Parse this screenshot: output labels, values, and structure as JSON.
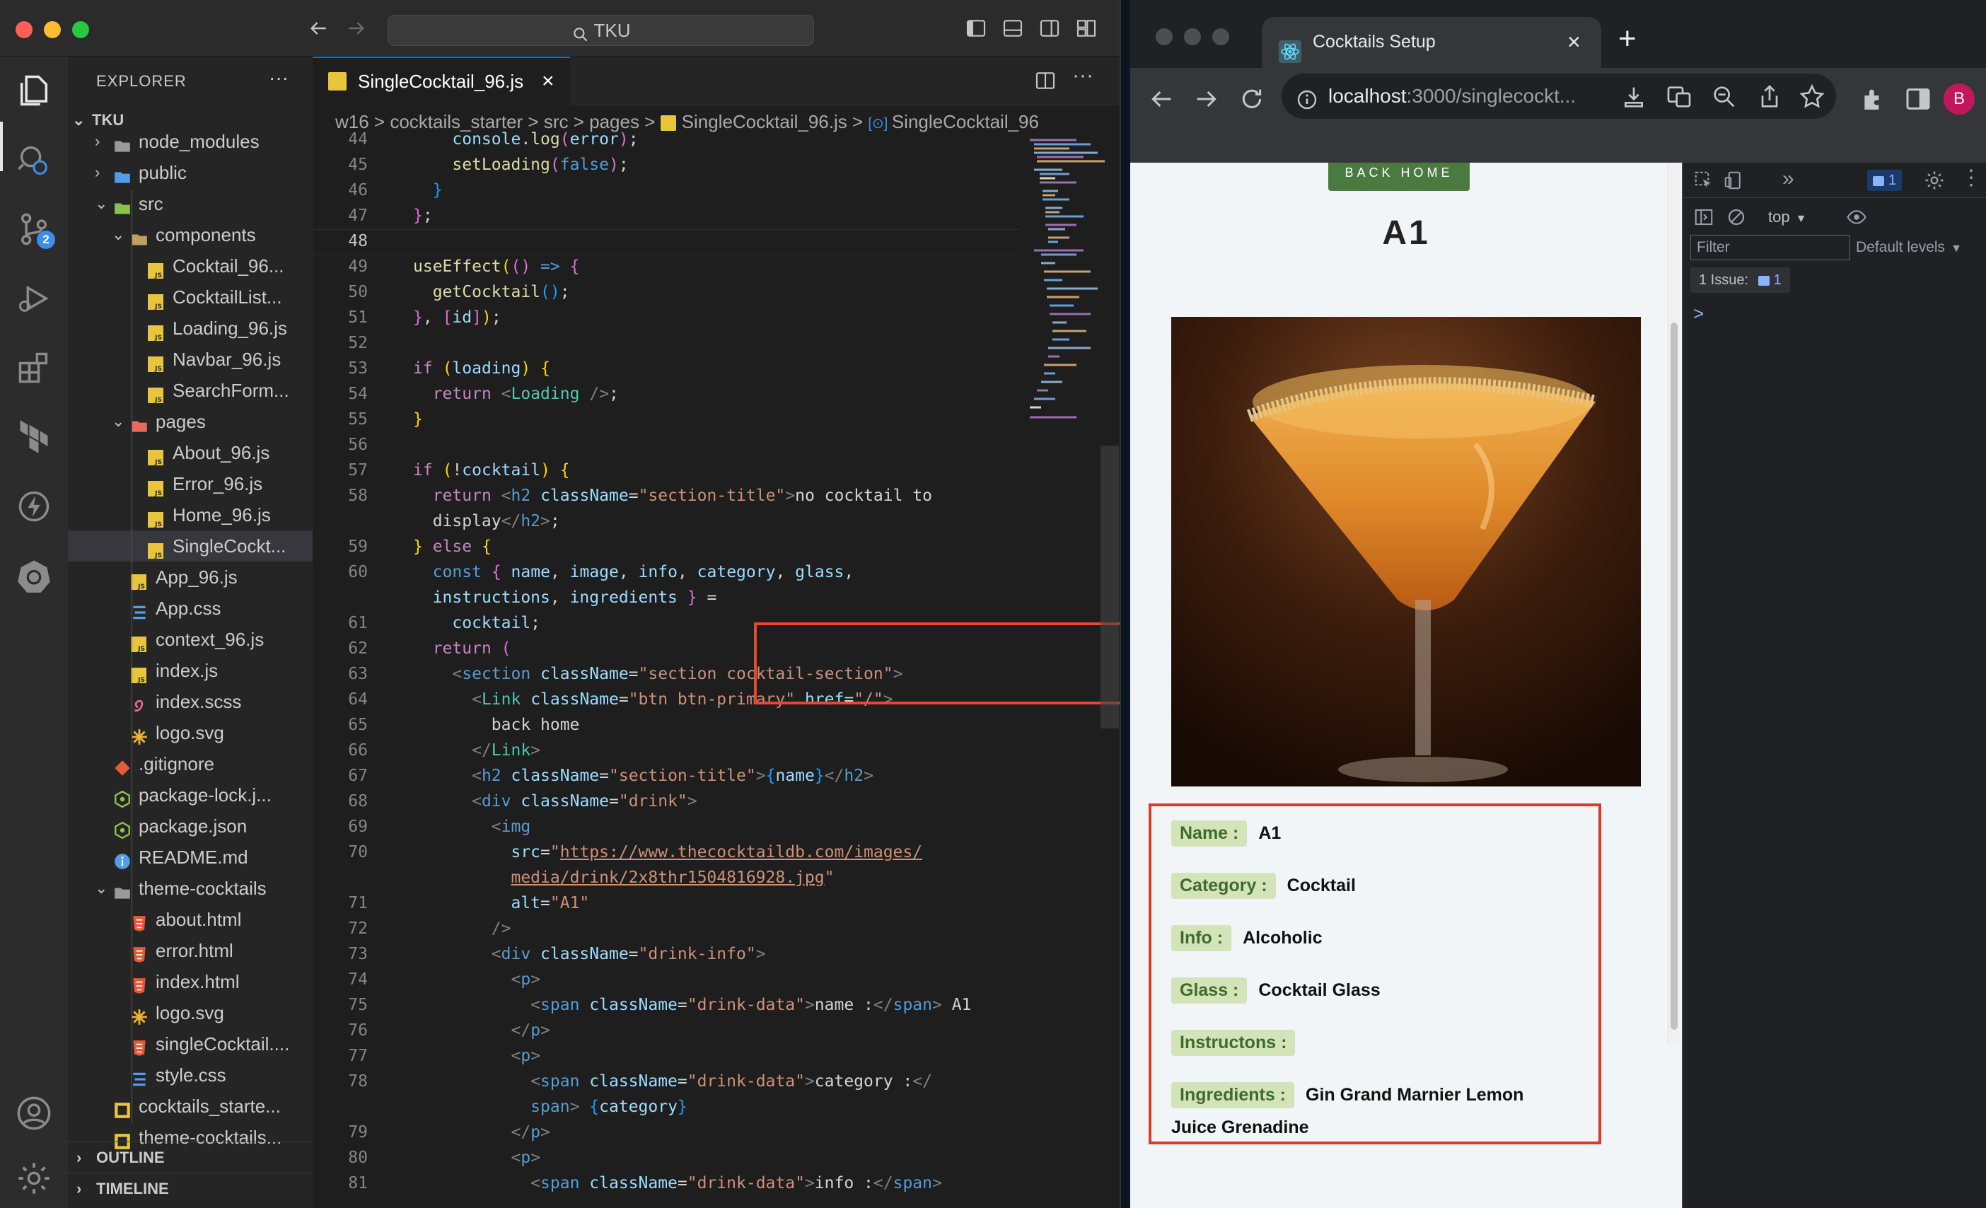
{
  "vscode": {
    "search_text": "TKU",
    "explorer_title": "EXPLORER",
    "explorer_more": "···",
    "scm_badge": "2",
    "tab_label": "SingleCocktail_96.js",
    "tab_close": "×",
    "breadcrumb": [
      "w16",
      "cocktails_starter",
      "src",
      "pages",
      "SingleCocktail_96.js",
      "SingleCocktail_96"
    ],
    "breadcrumb_sep": ">",
    "tree": [
      {
        "label": "TKU",
        "chev": "v",
        "icon": "root"
      },
      {
        "label": "node_modules",
        "chev": ">",
        "icon": "folder-node"
      },
      {
        "label": "public",
        "chev": ">",
        "icon": "folder-public"
      },
      {
        "label": "src",
        "chev": "v",
        "icon": "folder-src"
      },
      {
        "label": "components",
        "chev": "v",
        "icon": "folder-components"
      },
      {
        "label": "Cocktail_96...",
        "chev": "",
        "icon": "js"
      },
      {
        "label": "CocktailList...",
        "chev": "",
        "icon": "js"
      },
      {
        "label": "Loading_96.js",
        "chev": "",
        "icon": "js"
      },
      {
        "label": "Navbar_96.js",
        "chev": "",
        "icon": "js"
      },
      {
        "label": "SearchForm...",
        "chev": "",
        "icon": "js"
      },
      {
        "label": "pages",
        "chev": "v",
        "icon": "folder-pages"
      },
      {
        "label": "About_96.js",
        "chev": "",
        "icon": "js"
      },
      {
        "label": "Error_96.js",
        "chev": "",
        "icon": "js"
      },
      {
        "label": "Home_96.js",
        "chev": "",
        "icon": "js"
      },
      {
        "label": "SingleCockt...",
        "chev": "",
        "icon": "js"
      },
      {
        "label": "App_96.js",
        "chev": "",
        "icon": "js"
      },
      {
        "label": "App.css",
        "chev": "",
        "icon": "css"
      },
      {
        "label": "context_96.js",
        "chev": "",
        "icon": "js"
      },
      {
        "label": "index.js",
        "chev": "",
        "icon": "js"
      },
      {
        "label": "index.scss",
        "chev": "",
        "icon": "scss"
      },
      {
        "label": "logo.svg",
        "chev": "",
        "icon": "svg"
      },
      {
        "label": ".gitignore",
        "chev": "",
        "icon": "git"
      },
      {
        "label": "package-lock.j...",
        "chev": "",
        "icon": "npm"
      },
      {
        "label": "package.json",
        "chev": "",
        "icon": "npm"
      },
      {
        "label": "README.md",
        "chev": "",
        "icon": "info"
      },
      {
        "label": "theme-cocktails",
        "chev": "v",
        "icon": "folder-plain"
      },
      {
        "label": "about.html",
        "chev": "",
        "icon": "html"
      },
      {
        "label": "error.html",
        "chev": "",
        "icon": "html"
      },
      {
        "label": "index.html",
        "chev": "",
        "icon": "html"
      },
      {
        "label": "logo.svg",
        "chev": "",
        "icon": "svg"
      },
      {
        "label": "singleCocktail....",
        "chev": "",
        "icon": "html"
      },
      {
        "label": "style.css",
        "chev": "",
        "icon": "css"
      },
      {
        "label": "cocktails_starte...",
        "chev": "",
        "icon": "ws"
      },
      {
        "label": "theme-cocktails...",
        "chev": "",
        "icon": "ws"
      }
    ],
    "outline_label": "OUTLINE",
    "timeline_label": "TIMELINE",
    "line_numbers": [
      "44",
      "45",
      "46",
      "47",
      "48",
      "49",
      "50",
      "51",
      "52",
      "53",
      "54",
      "55",
      "56",
      "57",
      "58",
      "",
      "59",
      "60",
      "",
      "61",
      "62",
      "63",
      "64",
      "65",
      "66",
      "67",
      "68",
      "69",
      "70",
      "",
      "71",
      "72",
      "73",
      "74",
      "75",
      "76",
      "77",
      "78",
      "",
      "79",
      "80",
      "81"
    ]
  },
  "chrome": {
    "tab_title": "Cocktails Setup",
    "tab_close": "×",
    "new_tab": "+",
    "url_host": "localhost",
    "url_rest": ":3000/singlecockt...",
    "profile_initial": "B",
    "page": {
      "back_home": "BACK HOME",
      "title": "A1",
      "fields": [
        {
          "label": "Name :",
          "value": "A1"
        },
        {
          "label": "Category :",
          "value": "Cocktail"
        },
        {
          "label": "Info :",
          "value": "Alcoholic"
        },
        {
          "label": "Glass :",
          "value": "Cocktail Glass"
        },
        {
          "label": "Instructons :",
          "value": ""
        },
        {
          "label": "Ingredients :",
          "value": "Gin  Grand Marnier  Lemon"
        }
      ],
      "ingredients_wrap": "Juice  Grenadine"
    },
    "devtools": {
      "msg_count": "1",
      "context": "top",
      "filter_placeholder": "Filter",
      "levels": "Default levels",
      "issues_label": "1 Issue:",
      "issues_count": "1",
      "prompt": ">"
    }
  }
}
